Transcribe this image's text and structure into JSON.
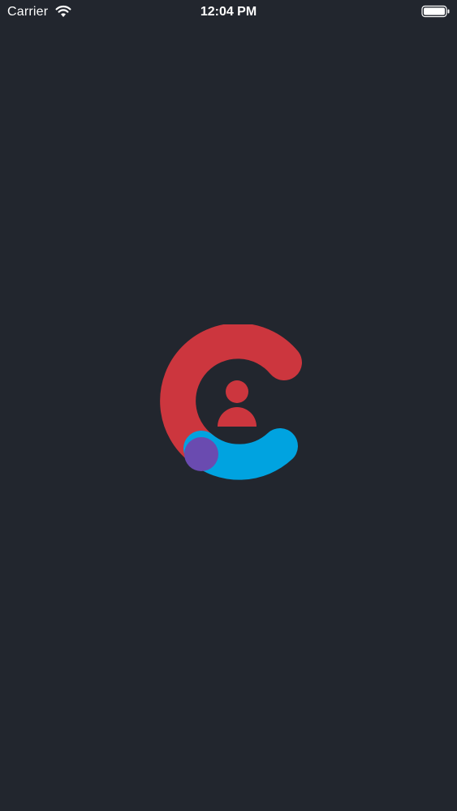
{
  "status_bar": {
    "carrier": "Carrier",
    "time": "12:04 PM",
    "wifi_icon": "wifi-icon",
    "battery_icon": "battery-icon"
  },
  "splash": {
    "logo_icon": "user-logo-icon",
    "colors": {
      "background": "#22262e",
      "logo_red": "#cc363e",
      "logo_blue": "#00a3e0",
      "logo_purple": "#6a4bb0"
    }
  }
}
